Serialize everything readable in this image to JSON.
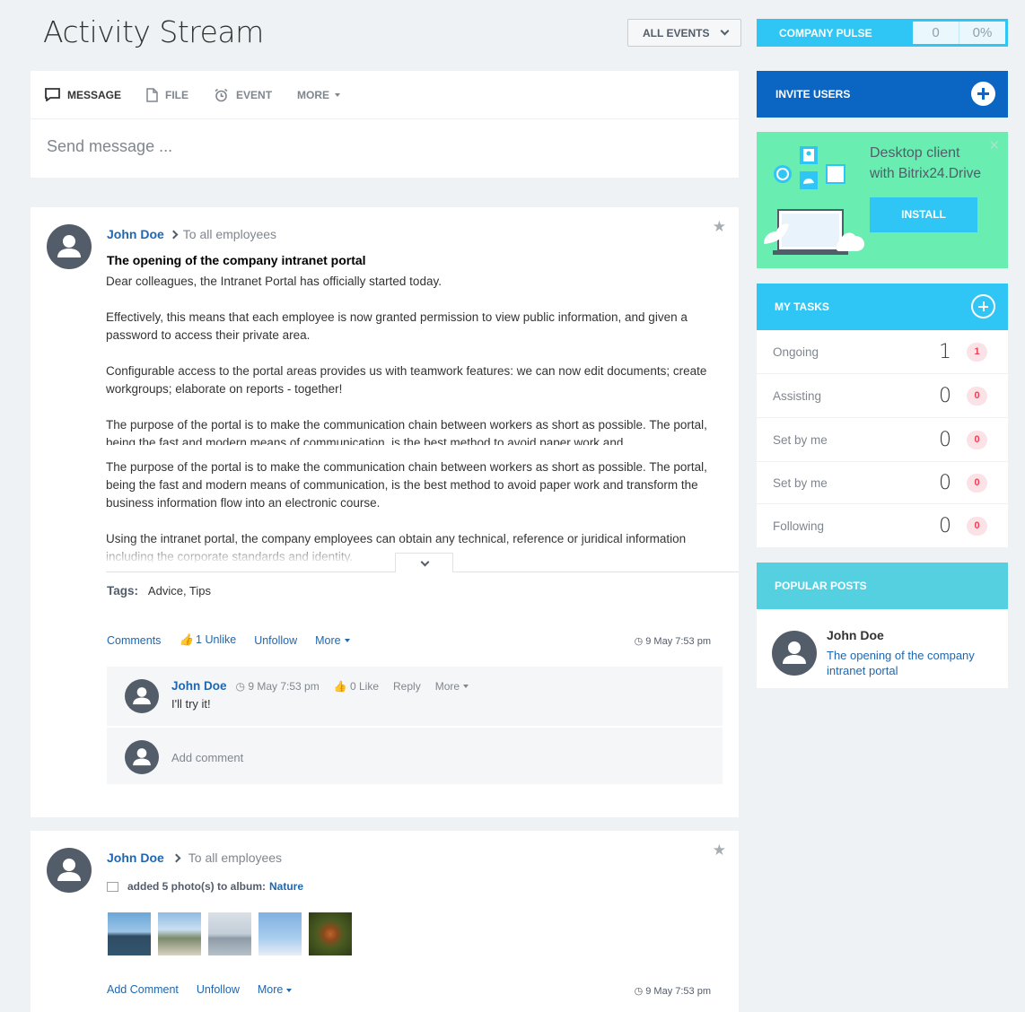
{
  "page": {
    "title": "Activity Stream",
    "filter_label": "ALL EVENTS"
  },
  "pulse": {
    "label": "COMPANY PULSE",
    "value": "0",
    "percent": "0%"
  },
  "composer": {
    "tabs": [
      {
        "label": "MESSAGE",
        "icon": "message-icon"
      },
      {
        "label": "FILE",
        "icon": "file-icon"
      },
      {
        "label": "EVENT",
        "icon": "alarm-clock-icon"
      },
      {
        "label": "MORE"
      }
    ],
    "placeholder": "Send message ..."
  },
  "post1": {
    "author": "John Doe",
    "destination": "To all employees",
    "title": "The opening of the company intranet portal",
    "paragraphs": [
      "Dear colleagues, the Intranet Portal has officially started today.",
      "Effectively, this means that each employee is now granted permission to view public information, and given a password to access their private area.",
      "Configurable access to the portal areas provides us with teamwork features: we can now edit documents; create workgroups; elaborate on reports - together!",
      "The purpose of the portal is to make the communication chain between workers as short as possible. The portal, being the fast and modern means of communication, is the best method to avoid paper work and"
    ],
    "more_paragraphs": [
      "The purpose of the portal is to make the communication chain between workers as short as possible. The portal, being the fast and modern means of communication, is the best method to avoid paper work and transform the business information flow into an electronic course.",
      "Using the intranet portal, the company employees can obtain any technical, reference or juridical information including the corporate standards and identity."
    ],
    "tags_label": "Tags:",
    "tags": "Advice, Tips",
    "actions": {
      "comments": "Comments",
      "like": "1 Unlike",
      "unfollow": "Unfollow",
      "more": "More"
    },
    "time": "9 May 7:53 pm",
    "comment": {
      "author": "John Doe",
      "time": "9 May 7:53 pm",
      "like": "0 Like",
      "reply": "Reply",
      "more": "More",
      "text": "I'll try it!"
    },
    "add_comment": "Add comment"
  },
  "post2": {
    "author": "John Doe",
    "destination": "To all employees",
    "activity": "added 5 photo(s) to album:",
    "album": "Nature",
    "actions": {
      "add_comment": "Add Comment",
      "unfollow": "Unfollow",
      "more": "More"
    },
    "time": "9 May 7:53 pm"
  },
  "sidebar": {
    "invite": "INVITE USERS",
    "desktop": {
      "title": "Desktop client",
      "subtitle": "with Bitrix24.Drive",
      "button": "INSTALL"
    },
    "tasks": {
      "header": "MY TASKS",
      "rows": [
        {
          "label": "Ongoing",
          "count": "1",
          "badge": "1"
        },
        {
          "label": "Assisting",
          "count": "0",
          "badge": "0"
        },
        {
          "label": "Set by me",
          "count": "0",
          "badge": "0"
        },
        {
          "label": "Set by me",
          "count": "0",
          "badge": "0"
        },
        {
          "label": "Following",
          "count": "0",
          "badge": "0"
        }
      ]
    },
    "popular": {
      "header": "POPULAR POSTS",
      "author": "John Doe",
      "title": "The opening of the company intranet portal"
    }
  },
  "colors": {
    "accent": "#2fc6f6",
    "link": "#2067b0",
    "invite": "#0b66c3",
    "desktop": "#6aedb1",
    "popular": "#55d0e0",
    "badge": "#ee3f54"
  }
}
